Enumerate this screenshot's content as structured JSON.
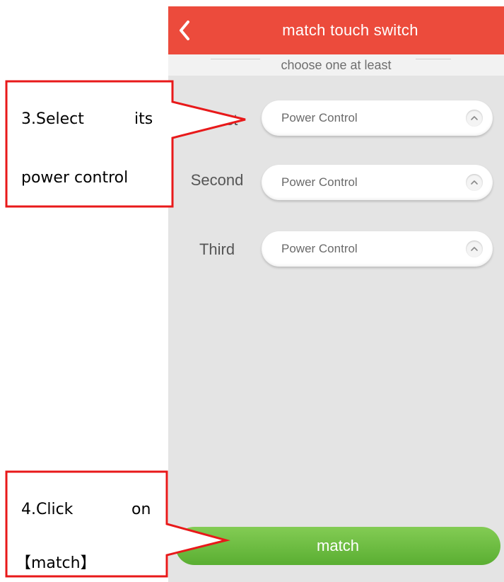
{
  "header": {
    "title": "match touch switch",
    "back_icon": "chevron-left-icon"
  },
  "subheader": {
    "text": "choose one at least"
  },
  "rows": [
    {
      "label": "First",
      "value": "Power Control",
      "icon": "chevron-up-icon"
    },
    {
      "label": "Second",
      "value": "Power Control",
      "icon": "chevron-up-icon"
    },
    {
      "label": "Third",
      "value": "Power Control",
      "icon": "chevron-up-icon"
    }
  ],
  "match_button": {
    "label": "match"
  },
  "annotations": {
    "step3": {
      "line1_left": "3.Select",
      "line1_right": "its",
      "line2": "power control"
    },
    "step4": {
      "line1_left": "4.Click",
      "line1_right": "on",
      "line2": "【match】"
    },
    "border_color": "#e8191a"
  },
  "colors": {
    "header_bg": "#ec4b3c",
    "screen_bg": "#e4e4e4",
    "button_green": "#6cbf3f"
  }
}
